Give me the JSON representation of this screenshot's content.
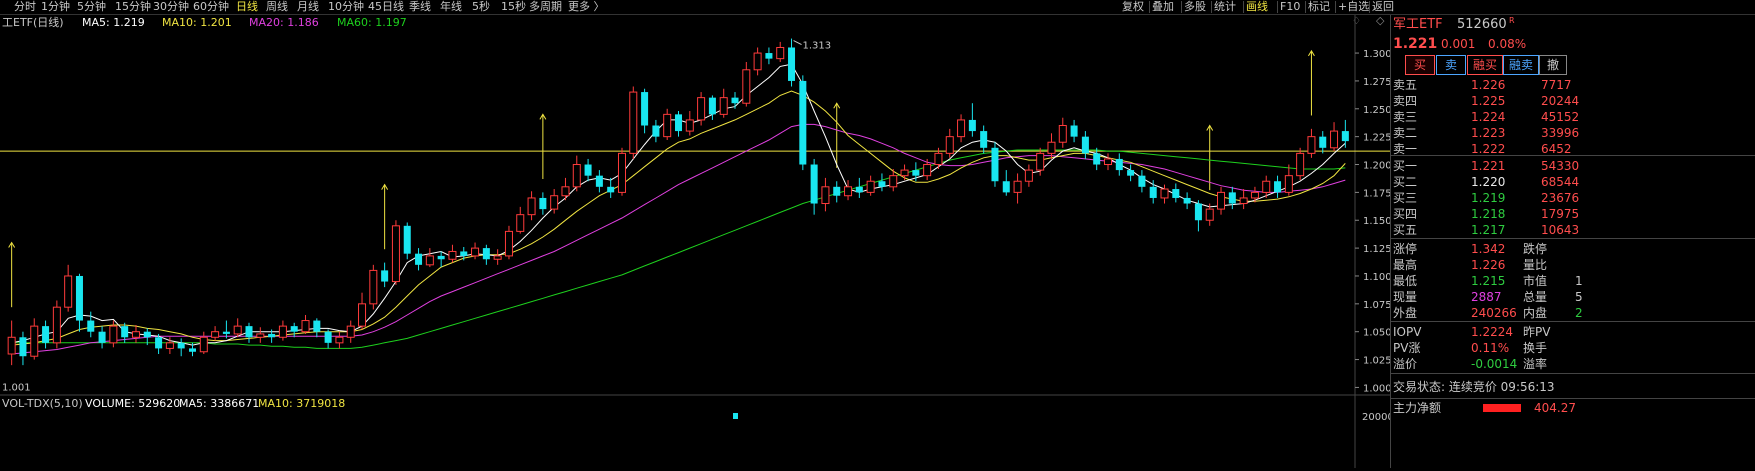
{
  "toolbar": {
    "periods": [
      {
        "label": "分时"
      },
      {
        "label": "1分钟"
      },
      {
        "label": "5分钟"
      },
      {
        "label": "15分钟"
      },
      {
        "label": "30分钟"
      },
      {
        "label": "60分钟"
      },
      {
        "label": "日线"
      },
      {
        "label": "周线"
      },
      {
        "label": "月线"
      },
      {
        "label": "10分钟"
      },
      {
        "label": "45日线"
      },
      {
        "label": "季线"
      },
      {
        "label": "年线"
      },
      {
        "label": "5秒"
      },
      {
        "label": "15秒"
      },
      {
        "label": "多周期"
      },
      {
        "label": "更多 〉"
      }
    ],
    "active_period": "日线",
    "tools": [
      {
        "label": "复权"
      },
      {
        "label": "叠加"
      },
      {
        "label": "多股"
      },
      {
        "label": "统计"
      },
      {
        "label": "画线"
      },
      {
        "label": "F10"
      },
      {
        "label": "标记"
      },
      {
        "label": "+自选"
      },
      {
        "label": "返回"
      }
    ],
    "active_tool": "画线"
  },
  "legend": {
    "name": "工ETF(日线)",
    "ma5": "MA5: 1.219",
    "ma10": "MA10: 1.201",
    "ma20": "MA20: 1.186",
    "ma60": "MA60: 1.197"
  },
  "volume_legend": {
    "name": "VOL-TDX(5,10)",
    "volume": "VOLUME: 529620",
    "ma5": "MA5: 3386671",
    "ma10": "MA10: 3719018"
  },
  "colors": {
    "up": "#ff3b3b",
    "down": "#19e6f0",
    "ma5": "#ffffff",
    "ma10": "#f0e442",
    "ma20": "#e040e0",
    "ma60": "#1ed01e",
    "price_line": "#f0e442"
  },
  "chart_data": {
    "type": "candlestick",
    "ylim": [
      0.995,
      1.318
    ],
    "y_ticks": [
      "1.300",
      "1.275",
      "1.250",
      "1.225",
      "1.200",
      "1.175",
      "1.150",
      "1.125",
      "1.100",
      "1.075",
      "1.050",
      "1.025",
      "1.000"
    ],
    "bottom_tick": "20000",
    "high_label": "1.313",
    "low_label": "1.001",
    "high_value": 1.313,
    "low_value": 1.001,
    "reference_price": 1.212,
    "candles": [
      [
        1.03,
        1.045,
        1.06,
        1.02
      ],
      [
        1.045,
        1.028,
        1.05,
        1.02
      ],
      [
        1.028,
        1.055,
        1.062,
        1.025
      ],
      [
        1.055,
        1.04,
        1.06,
        1.035
      ],
      [
        1.04,
        1.072,
        1.078,
        1.035
      ],
      [
        1.072,
        1.1,
        1.11,
        1.068
      ],
      [
        1.1,
        1.06,
        1.102,
        1.05
      ],
      [
        1.06,
        1.05,
        1.068,
        1.045
      ],
      [
        1.05,
        1.04,
        1.055,
        1.035
      ],
      [
        1.04,
        1.055,
        1.06,
        1.036
      ],
      [
        1.055,
        1.045,
        1.058,
        1.04
      ],
      [
        1.045,
        1.05,
        1.056,
        1.04
      ],
      [
        1.05,
        1.045,
        1.053,
        1.038
      ],
      [
        1.045,
        1.035,
        1.048,
        1.03
      ],
      [
        1.035,
        1.04,
        1.045,
        1.03
      ],
      [
        1.04,
        1.035,
        1.044,
        1.028
      ],
      [
        1.035,
        1.032,
        1.04,
        1.028
      ],
      [
        1.032,
        1.045,
        1.05,
        1.03
      ],
      [
        1.045,
        1.05,
        1.055,
        1.042
      ],
      [
        1.05,
        1.048,
        1.06,
        1.044
      ],
      [
        1.048,
        1.055,
        1.062,
        1.045
      ],
      [
        1.055,
        1.045,
        1.058,
        1.04
      ],
      [
        1.045,
        1.048,
        1.054,
        1.04
      ],
      [
        1.048,
        1.045,
        1.052,
        1.04
      ],
      [
        1.045,
        1.055,
        1.06,
        1.042
      ],
      [
        1.055,
        1.05,
        1.058,
        1.045
      ],
      [
        1.05,
        1.06,
        1.065,
        1.048
      ],
      [
        1.06,
        1.05,
        1.062,
        1.045
      ],
      [
        1.05,
        1.04,
        1.052,
        1.035
      ],
      [
        1.04,
        1.045,
        1.05,
        1.035
      ],
      [
        1.045,
        1.055,
        1.06,
        1.04
      ],
      [
        1.055,
        1.075,
        1.085,
        1.052
      ],
      [
        1.075,
        1.105,
        1.11,
        1.07
      ],
      [
        1.105,
        1.095,
        1.112,
        1.09
      ],
      [
        1.095,
        1.145,
        1.15,
        1.092
      ],
      [
        1.145,
        1.12,
        1.148,
        1.115
      ],
      [
        1.12,
        1.11,
        1.125,
        1.105
      ],
      [
        1.11,
        1.118,
        1.125,
        1.108
      ],
      [
        1.118,
        1.115,
        1.122,
        1.108
      ],
      [
        1.115,
        1.122,
        1.128,
        1.112
      ],
      [
        1.122,
        1.118,
        1.126,
        1.114
      ],
      [
        1.118,
        1.125,
        1.13,
        1.115
      ],
      [
        1.125,
        1.115,
        1.128,
        1.11
      ],
      [
        1.115,
        1.118,
        1.124,
        1.11
      ],
      [
        1.118,
        1.14,
        1.145,
        1.115
      ],
      [
        1.14,
        1.155,
        1.162,
        1.138
      ],
      [
        1.155,
        1.17,
        1.176,
        1.15
      ],
      [
        1.17,
        1.16,
        1.175,
        1.155
      ],
      [
        1.16,
        1.172,
        1.178,
        1.156
      ],
      [
        1.172,
        1.18,
        1.188,
        1.168
      ],
      [
        1.18,
        1.2,
        1.208,
        1.176
      ],
      [
        1.2,
        1.19,
        1.205,
        1.185
      ],
      [
        1.19,
        1.18,
        1.195,
        1.175
      ],
      [
        1.18,
        1.175,
        1.188,
        1.17
      ],
      [
        1.175,
        1.21,
        1.215,
        1.172
      ],
      [
        1.21,
        1.265,
        1.27,
        1.205
      ],
      [
        1.265,
        1.235,
        1.268,
        1.228
      ],
      [
        1.235,
        1.225,
        1.24,
        1.22
      ],
      [
        1.225,
        1.245,
        1.25,
        1.222
      ],
      [
        1.245,
        1.23,
        1.248,
        1.225
      ],
      [
        1.23,
        1.24,
        1.248,
        1.226
      ],
      [
        1.24,
        1.26,
        1.265,
        1.235
      ],
      [
        1.26,
        1.245,
        1.262,
        1.24
      ],
      [
        1.245,
        1.26,
        1.268,
        1.242
      ],
      [
        1.26,
        1.255,
        1.265,
        1.25
      ],
      [
        1.255,
        1.285,
        1.292,
        1.252
      ],
      [
        1.285,
        1.3,
        1.305,
        1.28
      ],
      [
        1.3,
        1.295,
        1.305,
        1.29
      ],
      [
        1.295,
        1.305,
        1.31,
        1.292
      ],
      [
        1.305,
        1.275,
        1.313,
        1.27
      ],
      [
        1.275,
        1.2,
        1.28,
        1.195
      ],
      [
        1.2,
        1.165,
        1.205,
        1.155
      ],
      [
        1.165,
        1.18,
        1.188,
        1.158
      ],
      [
        1.18,
        1.172,
        1.185,
        1.166
      ],
      [
        1.172,
        1.18,
        1.186,
        1.168
      ],
      [
        1.18,
        1.175,
        1.188,
        1.17
      ],
      [
        1.175,
        1.185,
        1.19,
        1.172
      ],
      [
        1.185,
        1.18,
        1.192,
        1.176
      ],
      [
        1.18,
        1.19,
        1.196,
        1.176
      ],
      [
        1.19,
        1.195,
        1.2,
        1.186
      ],
      [
        1.195,
        1.19,
        1.202,
        1.185
      ],
      [
        1.19,
        1.2,
        1.205,
        1.186
      ],
      [
        1.2,
        1.21,
        1.215,
        1.196
      ],
      [
        1.21,
        1.225,
        1.232,
        1.206
      ],
      [
        1.225,
        1.24,
        1.245,
        1.22
      ],
      [
        1.24,
        1.23,
        1.255,
        1.225
      ],
      [
        1.23,
        1.215,
        1.235,
        1.21
      ],
      [
        1.215,
        1.185,
        1.22,
        1.18
      ],
      [
        1.185,
        1.175,
        1.195,
        1.172
      ],
      [
        1.175,
        1.185,
        1.192,
        1.165
      ],
      [
        1.185,
        1.195,
        1.2,
        1.18
      ],
      [
        1.195,
        1.21,
        1.215,
        1.19
      ],
      [
        1.21,
        1.22,
        1.228,
        1.205
      ],
      [
        1.22,
        1.235,
        1.242,
        1.215
      ],
      [
        1.235,
        1.225,
        1.24,
        1.22
      ],
      [
        1.225,
        1.21,
        1.23,
        1.205
      ],
      [
        1.21,
        1.2,
        1.215,
        1.195
      ],
      [
        1.2,
        1.205,
        1.21,
        1.195
      ],
      [
        1.205,
        1.195,
        1.21,
        1.19
      ],
      [
        1.195,
        1.19,
        1.2,
        1.185
      ],
      [
        1.19,
        1.18,
        1.195,
        1.175
      ],
      [
        1.18,
        1.17,
        1.186,
        1.165
      ],
      [
        1.17,
        1.178,
        1.182,
        1.165
      ],
      [
        1.178,
        1.17,
        1.183,
        1.166
      ],
      [
        1.17,
        1.165,
        1.175,
        1.16
      ],
      [
        1.165,
        1.15,
        1.168,
        1.14
      ],
      [
        1.15,
        1.16,
        1.165,
        1.145
      ],
      [
        1.16,
        1.175,
        1.18,
        1.155
      ],
      [
        1.175,
        1.165,
        1.18,
        1.16
      ],
      [
        1.165,
        1.17,
        1.178,
        1.16
      ],
      [
        1.17,
        1.175,
        1.18,
        1.166
      ],
      [
        1.175,
        1.185,
        1.19,
        1.17
      ],
      [
        1.185,
        1.175,
        1.19,
        1.17
      ],
      [
        1.175,
        1.19,
        1.2,
        1.172
      ],
      [
        1.19,
        1.21,
        1.215,
        1.186
      ],
      [
        1.21,
        1.225,
        1.232,
        1.206
      ],
      [
        1.225,
        1.215,
        1.23,
        1.21
      ],
      [
        1.215,
        1.23,
        1.238,
        1.212
      ],
      [
        1.23,
        1.221,
        1.24,
        1.215
      ]
    ],
    "ma5": [
      1.04,
      1.042,
      1.045,
      1.048,
      1.05,
      1.062,
      1.065,
      1.064,
      1.06,
      1.061,
      1.05,
      1.048,
      1.047,
      1.046,
      1.042,
      1.04,
      1.038,
      1.04,
      1.04,
      1.042,
      1.046,
      1.05,
      1.05,
      1.05,
      1.05,
      1.051,
      1.052,
      1.053,
      1.053,
      1.051,
      1.05,
      1.055,
      1.066,
      1.08,
      1.095,
      1.112,
      1.118,
      1.12,
      1.122,
      1.117,
      1.118,
      1.12,
      1.119,
      1.118,
      1.123,
      1.131,
      1.141,
      1.152,
      1.162,
      1.17,
      1.18,
      1.186,
      1.188,
      1.186,
      1.192,
      1.205,
      1.218,
      1.23,
      1.24,
      1.24,
      1.237,
      1.24,
      1.245,
      1.25,
      1.252,
      1.262,
      1.27,
      1.278,
      1.288,
      1.29,
      1.272,
      1.248,
      1.225,
      1.2,
      1.178,
      1.175,
      1.178,
      1.18,
      1.182,
      1.185,
      1.188,
      1.191,
      1.198,
      1.205,
      1.215,
      1.22,
      1.222,
      1.22,
      1.212,
      1.2,
      1.192,
      1.194,
      1.204,
      1.212,
      1.215,
      1.212,
      1.21,
      1.206,
      1.2,
      1.195,
      1.188,
      1.182,
      1.178,
      1.173,
      1.168,
      1.165,
      1.162,
      1.163,
      1.164,
      1.165,
      1.168,
      1.172,
      1.176,
      1.18,
      1.185,
      1.192,
      1.2,
      1.21,
      1.219
    ],
    "ma10": [
      1.038,
      1.039,
      1.04,
      1.042,
      1.044,
      1.048,
      1.052,
      1.054,
      1.055,
      1.056,
      1.056,
      1.055,
      1.053,
      1.052,
      1.05,
      1.048,
      1.045,
      1.043,
      1.042,
      1.042,
      1.043,
      1.044,
      1.045,
      1.046,
      1.047,
      1.048,
      1.049,
      1.05,
      1.05,
      1.05,
      1.05,
      1.052,
      1.057,
      1.063,
      1.072,
      1.082,
      1.092,
      1.1,
      1.108,
      1.112,
      1.116,
      1.118,
      1.119,
      1.119,
      1.12,
      1.124,
      1.129,
      1.135,
      1.142,
      1.15,
      1.158,
      1.165,
      1.172,
      1.177,
      1.182,
      1.19,
      1.198,
      1.206,
      1.214,
      1.22,
      1.223,
      1.228,
      1.232,
      1.236,
      1.24,
      1.245,
      1.25,
      1.255,
      1.262,
      1.266,
      1.262,
      1.256,
      1.248,
      1.238,
      1.226,
      1.218,
      1.21,
      1.202,
      1.194,
      1.188,
      1.184,
      1.184,
      1.187,
      1.191,
      1.197,
      1.202,
      1.206,
      1.208,
      1.208,
      1.206,
      1.204,
      1.204,
      1.206,
      1.208,
      1.21,
      1.21,
      1.208,
      1.206,
      1.204,
      1.202,
      1.198,
      1.194,
      1.19,
      1.186,
      1.182,
      1.178,
      1.174,
      1.171,
      1.169,
      1.167,
      1.167,
      1.168,
      1.169,
      1.171,
      1.174,
      1.178,
      1.183,
      1.19,
      1.201
    ],
    "ma20": [
      1.03,
      1.031,
      1.032,
      1.033,
      1.034,
      1.036,
      1.038,
      1.04,
      1.041,
      1.042,
      1.043,
      1.044,
      1.045,
      1.046,
      1.046,
      1.046,
      1.046,
      1.046,
      1.046,
      1.046,
      1.046,
      1.046,
      1.046,
      1.046,
      1.046,
      1.046,
      1.046,
      1.046,
      1.046,
      1.046,
      1.046,
      1.047,
      1.05,
      1.054,
      1.059,
      1.065,
      1.071,
      1.077,
      1.082,
      1.086,
      1.09,
      1.094,
      1.098,
      1.102,
      1.106,
      1.11,
      1.114,
      1.118,
      1.122,
      1.127,
      1.132,
      1.137,
      1.142,
      1.147,
      1.152,
      1.158,
      1.164,
      1.17,
      1.176,
      1.182,
      1.187,
      1.192,
      1.197,
      1.202,
      1.207,
      1.212,
      1.217,
      1.222,
      1.228,
      1.234,
      1.236,
      1.236,
      1.234,
      1.231,
      1.228,
      1.226,
      1.223,
      1.219,
      1.215,
      1.21,
      1.206,
      1.202,
      1.2,
      1.199,
      1.199,
      1.2,
      1.202,
      1.204,
      1.206,
      1.207,
      1.208,
      1.208,
      1.208,
      1.207,
      1.206,
      1.205,
      1.204,
      1.203,
      1.202,
      1.201,
      1.2,
      1.198,
      1.196,
      1.193,
      1.19,
      1.187,
      1.184,
      1.181,
      1.179,
      1.177,
      1.176,
      1.175,
      1.175,
      1.176,
      1.177,
      1.178,
      1.18,
      1.183,
      1.186
    ],
    "ma60": [
      1.04,
      1.04,
      1.04,
      1.04,
      1.04,
      1.04,
      1.04,
      1.04,
      1.04,
      1.04,
      1.04,
      1.04,
      1.04,
      1.04,
      1.04,
      1.04,
      1.04,
      1.04,
      1.039,
      1.039,
      1.039,
      1.038,
      1.038,
      1.037,
      1.037,
      1.036,
      1.036,
      1.035,
      1.035,
      1.035,
      1.035,
      1.036,
      1.038,
      1.04,
      1.042,
      1.044,
      1.047,
      1.05,
      1.053,
      1.056,
      1.059,
      1.062,
      1.065,
      1.068,
      1.071,
      1.074,
      1.077,
      1.08,
      1.083,
      1.086,
      1.089,
      1.092,
      1.095,
      1.098,
      1.101,
      1.105,
      1.109,
      1.113,
      1.117,
      1.121,
      1.125,
      1.129,
      1.133,
      1.137,
      1.141,
      1.145,
      1.149,
      1.153,
      1.157,
      1.161,
      1.165,
      1.168,
      1.171,
      1.174,
      1.177,
      1.18,
      1.183,
      1.186,
      1.189,
      1.192,
      1.195,
      1.198,
      1.201,
      1.204,
      1.206,
      1.208,
      1.21,
      1.211,
      1.212,
      1.213,
      1.213,
      1.213,
      1.213,
      1.213,
      1.213,
      1.213,
      1.213,
      1.212,
      1.212,
      1.211,
      1.21,
      1.209,
      1.208,
      1.207,
      1.206,
      1.205,
      1.204,
      1.203,
      1.202,
      1.201,
      1.2,
      1.199,
      1.198,
      1.197,
      1.196,
      1.196,
      1.196,
      1.196,
      1.197
    ]
  },
  "quote": {
    "name": "军工ETF",
    "code": "512660",
    "badge": "R",
    "price": "1.221",
    "change": "0.001",
    "pct": "0.08%",
    "buttons": {
      "buy": "买",
      "sell": "卖",
      "margin_buy": "融买",
      "margin_sell": "融卖",
      "cancel": "撤"
    },
    "asks": [
      {
        "label": "卖五",
        "price": "1.226",
        "vol": "7717"
      },
      {
        "label": "卖四",
        "price": "1.225",
        "vol": "20244"
      },
      {
        "label": "卖三",
        "price": "1.224",
        "vol": "45152"
      },
      {
        "label": "卖二",
        "price": "1.223",
        "vol": "33996"
      },
      {
        "label": "卖一",
        "price": "1.222",
        "vol": "6452"
      }
    ],
    "bids": [
      {
        "label": "买一",
        "price": "1.221",
        "vol": "54330"
      },
      {
        "label": "买二",
        "price": "1.220",
        "vol": "68544"
      },
      {
        "label": "买三",
        "price": "1.219",
        "vol": "23676"
      },
      {
        "label": "买四",
        "price": "1.218",
        "vol": "17975"
      },
      {
        "label": "买五",
        "price": "1.217",
        "vol": "10643"
      }
    ],
    "stats": [
      {
        "l1": "涨停",
        "v1": "1.342",
        "l2": "跌停",
        "v2": ""
      },
      {
        "l1": "最高",
        "v1": "1.226",
        "l2": "量比",
        "v2": ""
      },
      {
        "l1": "最低",
        "v1": "1.215",
        "l2": "市值",
        "v2": "1"
      },
      {
        "l1": "现量",
        "v1": "2887",
        "l2": "总量",
        "v2": "5"
      },
      {
        "l1": "外盘",
        "v1": "240266",
        "l2": "内盘",
        "v2": "2"
      }
    ],
    "iopv": [
      {
        "l1": "IOPV",
        "v1": "1.2224",
        "l2": "昨PV",
        "v2": ""
      },
      {
        "l1": "PV涨",
        "v1": "0.11%",
        "l2": "换手",
        "v2": ""
      },
      {
        "l1": "溢价",
        "v1": "-0.0014",
        "l2": "溢率",
        "v2": ""
      }
    ],
    "trade_status": "交易状态: 连续竞价 09:56:13",
    "net_inflow_label": "主力净额",
    "net_inflow_value": "404.27"
  }
}
